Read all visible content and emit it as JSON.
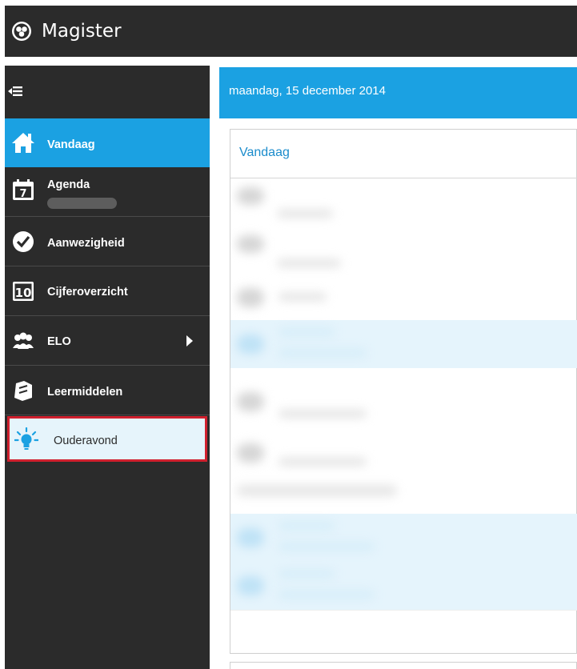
{
  "header": {
    "app_title": "Magister",
    "logo_icon": "magister-logo-icon"
  },
  "sidebar": {
    "collapse_icon": "collapse-menu-icon",
    "items": [
      {
        "label": "Vandaag",
        "icon": "home-icon",
        "active": true
      },
      {
        "label": "Agenda",
        "icon": "calendar-icon",
        "sublabel_blurred": true
      },
      {
        "label": "Aanwezigheid",
        "icon": "checkmark-icon"
      },
      {
        "label": "Cijferoverzicht",
        "icon": "grades-10-icon",
        "icon_text": "10"
      },
      {
        "label": "ELO",
        "icon": "people-icon",
        "has_submenu": true
      },
      {
        "label": "Leermiddelen",
        "icon": "puzzle-icon"
      },
      {
        "label": "Ouderavond",
        "icon": "lightbulb-icon",
        "highlighted": true
      }
    ]
  },
  "main": {
    "date_label": "maandag, 15 december 2014",
    "panel_title": "Vandaag"
  },
  "colors": {
    "dark": "#2b2b2b",
    "accent": "#1ba1e2",
    "highlight_border": "#d0202e",
    "highlight_bg": "#e6f4fb"
  }
}
